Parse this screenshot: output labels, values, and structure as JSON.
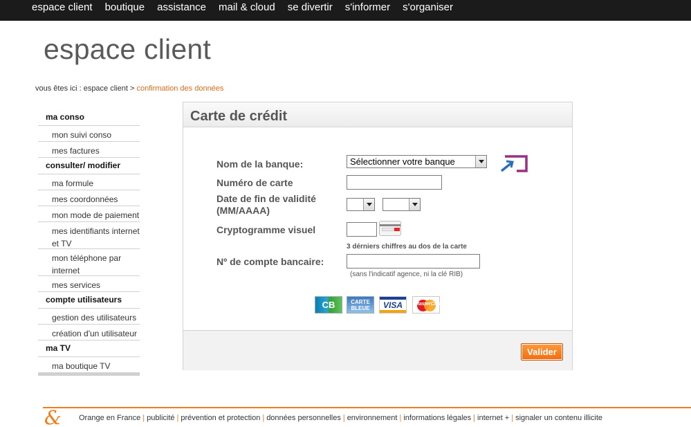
{
  "top_nav": {
    "items": [
      "espace client",
      "boutique",
      "assistance",
      "mail & cloud",
      "se divertir",
      "s'informer",
      "s'organiser"
    ]
  },
  "header": {
    "title": "espace client"
  },
  "breadcrumb": {
    "prefix": "vous êtes ici : espace client >",
    "current": "confirmation des données"
  },
  "sidebar": {
    "sections": [
      {
        "title": "ma conso",
        "items": [
          "mon suivi conso",
          "mes factures"
        ]
      },
      {
        "title": "consulter/ modifier",
        "items": [
          "ma formule",
          "mes coordonnées",
          "mon mode de paiement",
          "mes identifiants internet et TV",
          "mon téléphone par internet",
          "mes services"
        ]
      },
      {
        "title": "compte utilisateurs",
        "items": [
          "gestion des utilisateurs",
          "création d'un utilisateur"
        ]
      },
      {
        "title": "ma TV",
        "items": [
          "ma boutique TV"
        ]
      }
    ]
  },
  "panel": {
    "title": "Carte de crédit",
    "bank_label": "Nom de la banque:",
    "bank_select_value": "Sélectionner votre banque",
    "card_number_label": "Numéro de carte",
    "card_number_value": "",
    "expiry_label_line1": "Date de fin de validité",
    "expiry_label_line2": "(MM/AAAA)",
    "expiry_month_value": "",
    "expiry_year_value": "",
    "cvv_label": "Cryptogramme visuel",
    "cvv_value": "",
    "cvv_hint": "3 dérniers chiffres au dos de la carte",
    "account_label": "Nº de compte bancaire:",
    "account_value": "",
    "account_hint": "(sans l'indicatif agence, ni la clé RIB)",
    "card_logos": {
      "cb": "CB",
      "carte_bleue": [
        "CARTE",
        "BLEUE"
      ],
      "visa": "VISA",
      "mastercard": "MasterCard"
    },
    "submit_label": "Valider"
  },
  "footer": {
    "logo": "&",
    "links": [
      "Orange en France",
      "publicité",
      "prévention et protection",
      "données personnelles",
      "environnement",
      "informations légales",
      "internet +",
      "signaler un contenu illicite"
    ]
  },
  "colors": {
    "accent": "#f07d1a",
    "topbar": "#1b1b1b",
    "transfer_icon": "#9b2f86"
  }
}
